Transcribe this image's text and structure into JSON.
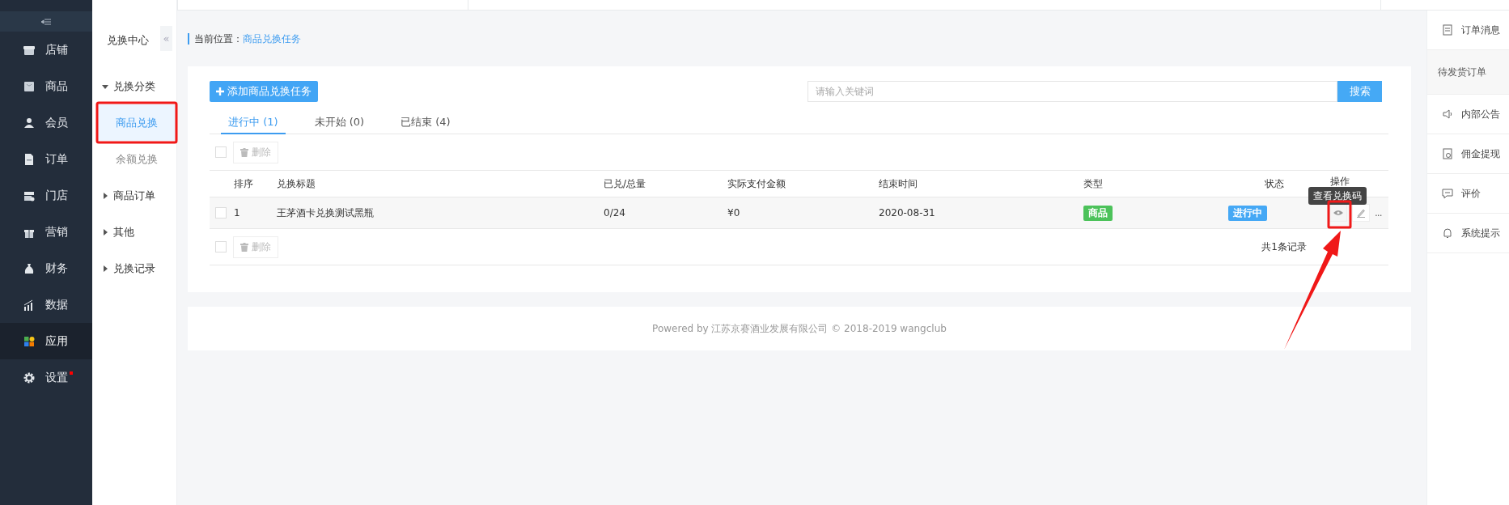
{
  "nav": {
    "items": [
      {
        "label": "店铺",
        "selected": false,
        "notice": false
      },
      {
        "label": "商品",
        "selected": false,
        "notice": false
      },
      {
        "label": "会员",
        "selected": false,
        "notice": false
      },
      {
        "label": "订单",
        "selected": false,
        "notice": false
      },
      {
        "label": "门店",
        "selected": false,
        "notice": false
      },
      {
        "label": "营销",
        "selected": false,
        "notice": false
      },
      {
        "label": "财务",
        "selected": false,
        "notice": false
      },
      {
        "label": "数据",
        "selected": false,
        "notice": false
      },
      {
        "label": "应用",
        "selected": true,
        "notice": false
      },
      {
        "label": "设置",
        "selected": false,
        "notice": true
      }
    ]
  },
  "subnav": {
    "title": "兑换中心",
    "collapse_button": "«",
    "items": [
      {
        "label": "兑换分类",
        "expanded": true,
        "children": [
          {
            "label": "商品兑换",
            "selected": true
          },
          {
            "label": "余额兑换",
            "selected": false
          }
        ]
      },
      {
        "label": "商品订单",
        "expanded": false
      },
      {
        "label": "其他",
        "expanded": false
      },
      {
        "label": "兑换记录",
        "expanded": false
      }
    ]
  },
  "breadcrumb": {
    "label": "当前位置：",
    "current": "商品兑换任务"
  },
  "add_button": "添加商品兑换任务",
  "search": {
    "placeholder": "请输入关键词",
    "button": "搜索"
  },
  "tabs": [
    {
      "label": "进行中 (1)",
      "selected": true
    },
    {
      "label": "未开始 (0)",
      "selected": false
    },
    {
      "label": "已结束 (4)",
      "selected": false
    }
  ],
  "table": {
    "select_all_checked": false,
    "delete_button": "删除",
    "columns": [
      "排序",
      "兑换标题",
      "已兑/总量",
      "实际支付金额",
      "结束时间",
      "类型",
      "状态",
      "操作"
    ],
    "rows": [
      {
        "checked": false,
        "index": "1",
        "title": "王茅酒卡兑换测试黑瓶",
        "redeemed": "0/24",
        "paid": "¥0",
        "end_date": "2020-08-31",
        "type": {
          "label": "商品",
          "color": "#4cc25a"
        },
        "status": {
          "label": "进行中",
          "color": "#45a8f5"
        },
        "more": "...",
        "tooltip": "查看兑换码"
      }
    ],
    "footer_select_all_checked": false,
    "footer_delete_button": "删除",
    "total": "共1条记录"
  },
  "footer": "Powered by 江苏京赛酒业发展有限公司 © 2018-2019 wangclub",
  "notices": {
    "items": [
      {
        "label": "订单消息",
        "kind": "item"
      },
      {
        "label": "待发货订单",
        "kind": "sub"
      },
      {
        "label": "内部公告",
        "kind": "item"
      },
      {
        "label": "佣金提现",
        "kind": "item"
      },
      {
        "label": "评价",
        "kind": "item"
      },
      {
        "label": "系统提示",
        "kind": "item"
      }
    ]
  }
}
